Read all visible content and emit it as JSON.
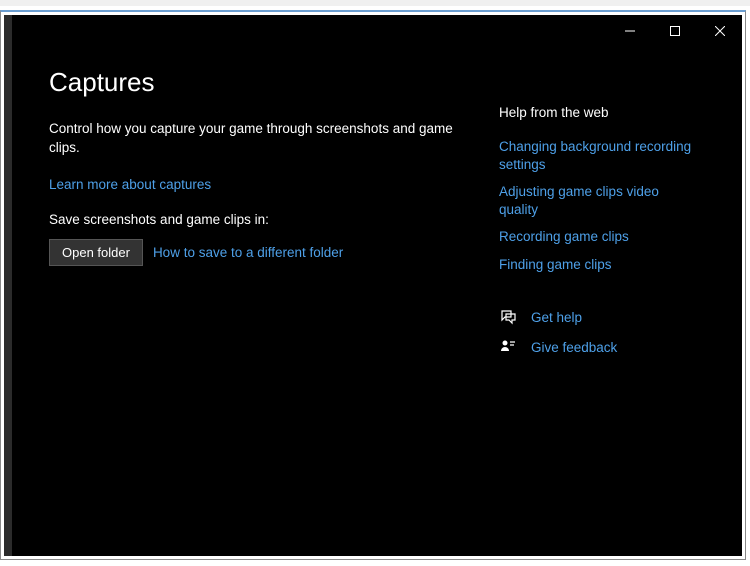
{
  "page": {
    "title": "Captures",
    "description": "Control how you capture your game through screenshots and game clips.",
    "learn_more": "Learn more about captures",
    "save_label": "Save screenshots and game clips in:",
    "open_folder_button": "Open folder",
    "save_different_link": "How to save to a different folder"
  },
  "sidebar": {
    "heading": "Help from the web",
    "links": [
      "Changing background recording settings",
      "Adjusting game clips video quality",
      "Recording game clips",
      "Finding game clips"
    ],
    "get_help": "Get help",
    "give_feedback": "Give feedback"
  }
}
